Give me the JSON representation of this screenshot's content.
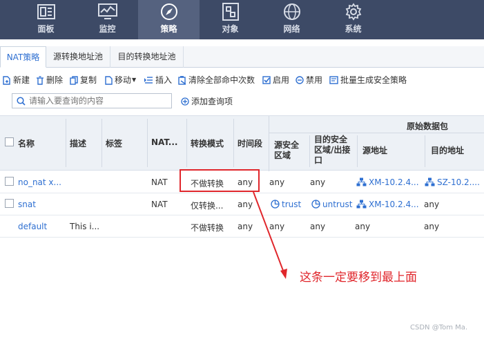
{
  "nav": {
    "items": [
      {
        "label": "面板",
        "icon": "dashboard-icon"
      },
      {
        "label": "监控",
        "icon": "monitor-icon"
      },
      {
        "label": "策略",
        "icon": "compass-icon"
      },
      {
        "label": "对象",
        "icon": "object-icon"
      },
      {
        "label": "网络",
        "icon": "globe-icon"
      },
      {
        "label": "系统",
        "icon": "gear-icon"
      }
    ],
    "active": "策略"
  },
  "tabs": [
    "NAT策略",
    "源转换地址池",
    "目的转换地址池"
  ],
  "toolbar": {
    "new": "新建",
    "delete": "删除",
    "copy": "复制",
    "move": "移动",
    "insert": "插入",
    "clear_hits": "清除全部命中次数",
    "enable": "启用",
    "disable": "禁用",
    "batch_generate": "批量生成安全策略"
  },
  "search": {
    "placeholder": "请输入要查询的内容",
    "add_query": "添加查询项"
  },
  "table": {
    "group_header": "原始数据包",
    "headers": {
      "name": "名称",
      "desc": "描述",
      "tag": "标签",
      "nat": "NAT...",
      "mode": "转换模式",
      "time": "时间段",
      "src_zone": "源安全区域",
      "dst_zone": "目的安全区域/出接口",
      "src_addr": "源地址",
      "dst_addr": "目的地址"
    },
    "rows": [
      {
        "name": "no_nat x...",
        "desc": "",
        "tag": "",
        "nat": "NAT",
        "mode": "不做转换",
        "time": "any",
        "src_zone": "any",
        "dst_zone": "any",
        "src_addr": "XM-10.2.4...",
        "dst_addr": "SZ-10.2...."
      },
      {
        "name": "snat",
        "desc": "",
        "tag": "",
        "nat": "NAT",
        "mode": "仅转换...",
        "time": "any",
        "src_zone": "trust",
        "dst_zone": "untrust",
        "src_addr": "XM-10.2.4...",
        "dst_addr": "any"
      },
      {
        "name": "default",
        "desc": "This i...",
        "tag": "",
        "nat": "",
        "mode": "不做转换",
        "time": "any",
        "src_zone": "any",
        "dst_zone": "any",
        "src_addr": "any",
        "dst_addr": "any"
      }
    ]
  },
  "annotation": "这条一定要移到最上面",
  "watermark": "CSDN @Tom Ma.",
  "colors": {
    "nav_bg": "#3d4a66",
    "nav_active": "#55627f",
    "link": "#2e6fd1",
    "annotation_red": "#e0262b"
  }
}
